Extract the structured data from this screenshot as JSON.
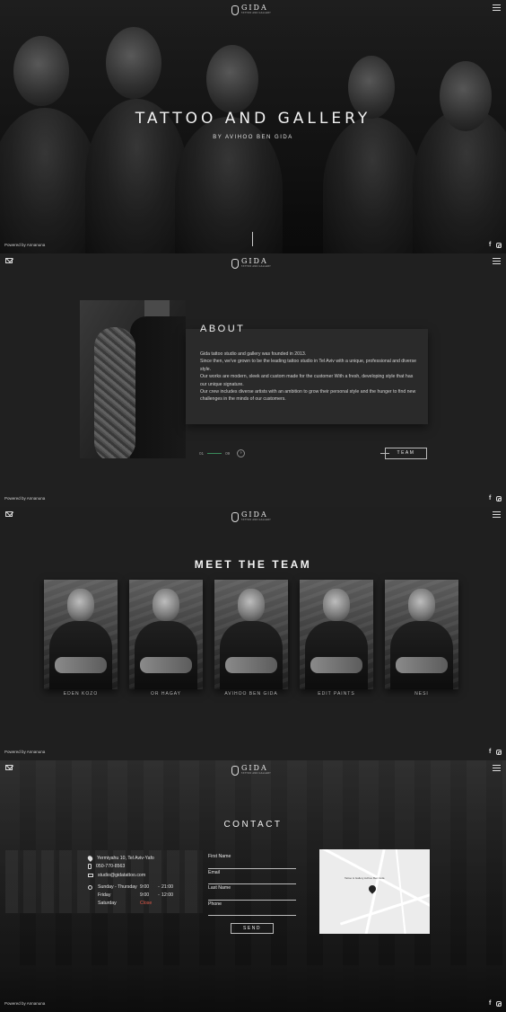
{
  "brand": {
    "name": "GIDA",
    "tagline": "TATTOO AND GALLERY"
  },
  "hero": {
    "title": "TATTOO AND GALLERY",
    "subtitle": "BY AVIHOO BEN GIDA"
  },
  "footer": {
    "powered": "Powered by Annanuna"
  },
  "about": {
    "title": "ABOUT",
    "paragraphs": [
      "Gida tattoo studio and gallery was founded in 2013.",
      "Since then, we've grown to be the leading tattoo studio in Tel Aviv with a unique, professional and diverse style.",
      "Our works are modern, sleek and custom made for the customer With a fresh, developing style that has our unique signature.",
      "Our crew includes diverse artists with an ambition to grow their personal style and the hunger to find new challenges in the minds of our customers."
    ],
    "pager": {
      "current": "01",
      "total": "09"
    },
    "team_button": "TEAM"
  },
  "team": {
    "title": "MEET THE TEAM",
    "members": [
      {
        "name": "EDEN KOZO"
      },
      {
        "name": "OR HAGAY"
      },
      {
        "name": "AVIHOO BEN GIDA"
      },
      {
        "name": "EDIT PAINTS"
      },
      {
        "name": "NESI"
      }
    ]
  },
  "contact": {
    "title": "CONTACT",
    "address": "Yermiyahu 10, Tel Aviv-Yafo",
    "phone": "050-770-8563",
    "email": "studio@gidatattoo.com",
    "hours": [
      {
        "day": "Sunday - Thursday",
        "open": "9:00",
        "close": "21:00"
      },
      {
        "day": "Friday",
        "open": "9:00",
        "close": "12:00"
      },
      {
        "day": "Saturday",
        "status": "Close"
      }
    ],
    "form": {
      "first_name": "First Name",
      "email": "Email",
      "last_name": "Last Name",
      "phone": "Phone",
      "send": "SEND"
    },
    "map_label": "Tattoo & Gallery Avihoo Ben Gida"
  },
  "colors": {
    "background": "#1c1c1c",
    "accent_line": "#3a8a5a",
    "closed": "#e05a4a"
  }
}
